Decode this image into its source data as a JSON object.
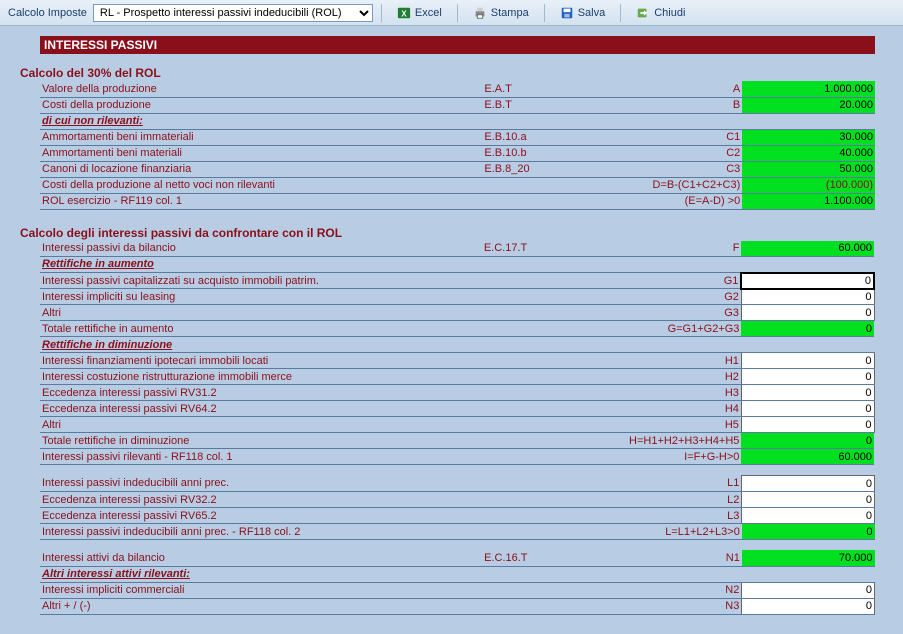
{
  "toolbar": {
    "label": "Calcolo Imposte",
    "select_value": "RL - Prospetto interessi passivi indeducibili (ROL)",
    "excel": "Excel",
    "stampa": "Stampa",
    "salva": "Salva",
    "chiudi": "Chiudi"
  },
  "title": "INTERESSI PASSIVI",
  "s1": {
    "head": "Calcolo del 30% del ROL",
    "r1": {
      "d": "Valore della produzione",
      "ref": "E.A.T",
      "c": "A",
      "v": "1.000.000"
    },
    "r2": {
      "d": "Costi della produzione",
      "ref": "E.B.T",
      "c": "B",
      "v": "20.000"
    },
    "sub": "di cui non rilevanti:",
    "r3": {
      "d": "Ammortamenti beni immateriali",
      "ref": "E.B.10.a",
      "c": "C1",
      "v": "30.000"
    },
    "r4": {
      "d": "Ammortamenti beni materiali",
      "ref": "E.B.10.b",
      "c": "C2",
      "v": "40.000"
    },
    "r5": {
      "d": "Canoni di locazione finanziaria",
      "ref": "E.B.8_20",
      "c": "C3",
      "v": "50.000"
    },
    "r6": {
      "d": "Costi della produzione al netto voci non rilevanti",
      "c": "D=B-(C1+C2+C3)",
      "v": "(100.000)"
    },
    "r7": {
      "d": "ROL esercizio - RF119 col. 1",
      "c": "(E=A-D) >0",
      "v": "1.100.000"
    }
  },
  "s2": {
    "head": "Calcolo degli interessi passivi da confrontare con il ROL",
    "r1": {
      "d": "Interessi passivi da bilancio",
      "ref": "E.C.17.T",
      "c": "F",
      "v": "60.000"
    },
    "sub1": "Rettifiche in aumento",
    "r2": {
      "d": "Interessi passivi capitalizzati su acquisto immobili patrim.",
      "c": "G1",
      "v": "0"
    },
    "r3": {
      "d": "Interessi impliciti su leasing",
      "c": "G2",
      "v": "0"
    },
    "r4": {
      "d": "Altri",
      "c": "G3",
      "v": "0"
    },
    "r5": {
      "d": "Totale rettifiche in aumento",
      "c": "G=G1+G2+G3",
      "v": "0"
    },
    "sub2": "Rettifiche in diminuzione",
    "r6": {
      "d": "Interessi finanziamenti ipotecari immobili locati",
      "c": "H1",
      "v": "0"
    },
    "r7": {
      "d": "Interessi costuzione ristrutturazione immobili merce",
      "c": "H2",
      "v": "0"
    },
    "r8": {
      "d": "Eccedenza interessi passivi RV31.2",
      "c": "H3",
      "v": "0"
    },
    "r9": {
      "d": "Eccedenza interessi passivi RV64.2",
      "c": "H4",
      "v": "0"
    },
    "r10": {
      "d": "Altri",
      "c": "H5",
      "v": "0"
    },
    "r11": {
      "d": "Totale rettifiche in diminuzione",
      "c": "H=H1+H2+H3+H4+H5",
      "v": "0"
    },
    "r12": {
      "d": "Interessi passivi rilevanti - RF118 col. 1",
      "c": "I=F+G-H>0",
      "v": "60.000"
    }
  },
  "s3": {
    "r1": {
      "d": "Interessi passivi indeducibili anni prec.",
      "c": "L1",
      "v": "0"
    },
    "r2": {
      "d": "Eccedenza interessi passivi RV32.2",
      "c": "L2",
      "v": "0"
    },
    "r3": {
      "d": "Eccedenza interessi passivi RV65.2",
      "c": "L3",
      "v": "0"
    },
    "r4": {
      "d": "Interessi passivi indeducibili anni prec. - RF118 col. 2",
      "c": "L=L1+L2+L3>0",
      "v": "0"
    }
  },
  "s4": {
    "r1": {
      "d": "Interessi attivi da bilancio",
      "ref": "E.C.16.T",
      "c": "N1",
      "v": "70.000"
    },
    "sub": "Altri interessi attivi rilevanti:",
    "r2": {
      "d": "Interessi impliciti commerciali",
      "c": "N2",
      "v": "0"
    },
    "r3": {
      "d": "Altri + / (-)",
      "c": "N3",
      "v": "0"
    }
  }
}
